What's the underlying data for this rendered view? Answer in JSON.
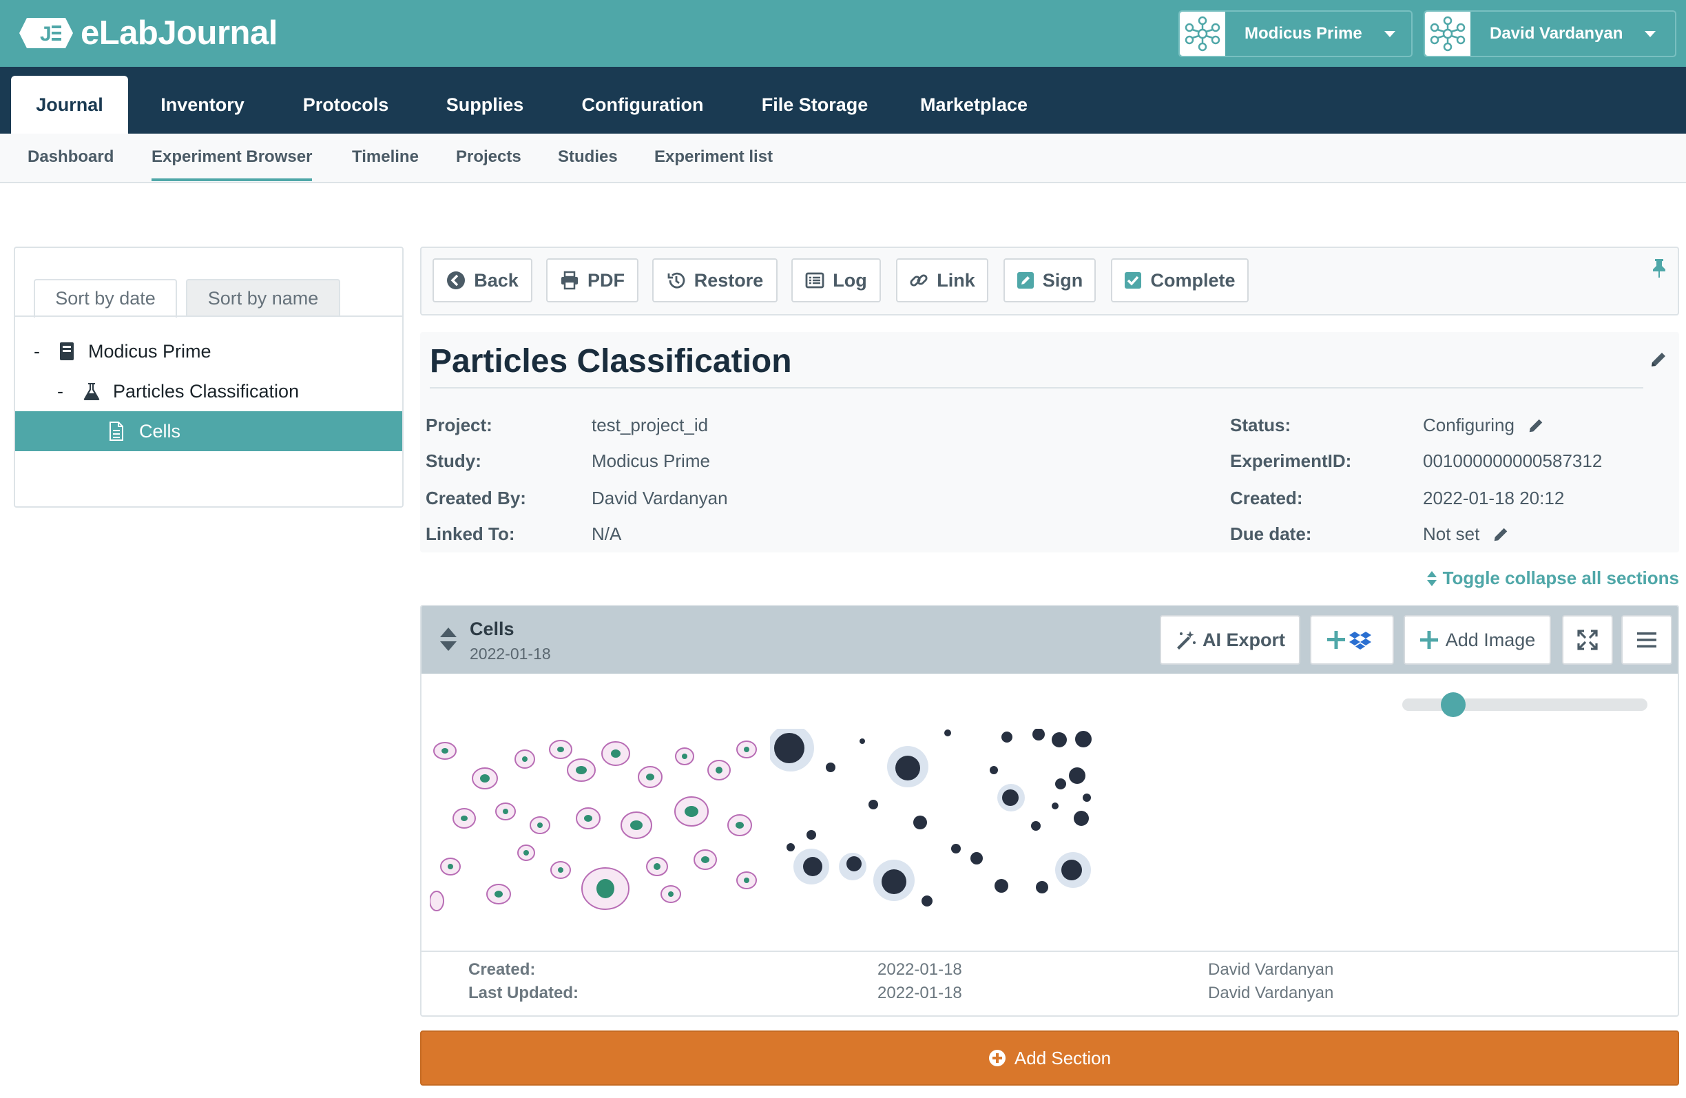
{
  "app": {
    "name": "eLabJournal",
    "logo_letter": "J"
  },
  "accounts": [
    {
      "name": "Modicus Prime"
    },
    {
      "name": "David Vardanyan"
    }
  ],
  "main_nav": [
    "Journal",
    "Inventory",
    "Protocols",
    "Supplies",
    "Configuration",
    "File Storage",
    "Marketplace"
  ],
  "main_nav_active": "Journal",
  "sub_nav": [
    "Dashboard",
    "Experiment Browser",
    "Timeline",
    "Projects",
    "Studies",
    "Experiment list"
  ],
  "sub_nav_active": "Experiment Browser",
  "sidebar": {
    "sort_tabs": [
      "Sort by date",
      "Sort by name"
    ],
    "tree": [
      {
        "toggle": "-",
        "label": "Modicus Prime",
        "icon": "book-icon"
      },
      {
        "toggle": "-",
        "label": "Particles Classification",
        "icon": "flask-icon"
      },
      {
        "toggle": "",
        "label": "Cells",
        "icon": "file-icon",
        "selected": true
      }
    ]
  },
  "toolbar": {
    "buttons": [
      {
        "label": "Back",
        "icon": "back-circle-icon"
      },
      {
        "label": "PDF",
        "icon": "printer-icon"
      },
      {
        "label": "Restore",
        "icon": "history-icon"
      },
      {
        "label": "Log",
        "icon": "list-icon"
      },
      {
        "label": "Link",
        "icon": "link-icon"
      },
      {
        "label": "Sign",
        "icon": "sign-icon"
      },
      {
        "label": "Complete",
        "icon": "check-square-icon"
      }
    ]
  },
  "experiment": {
    "title": "Particles Classification",
    "fields_left": [
      {
        "label": "Project:",
        "value": "test_project_id"
      },
      {
        "label": "Study:",
        "value": "Modicus Prime"
      },
      {
        "label": "Created By:",
        "value": "David Vardanyan"
      },
      {
        "label": "Linked To:",
        "value": "N/A"
      }
    ],
    "fields_right": [
      {
        "label": "Status:",
        "value": "Configuring"
      },
      {
        "label": "ExperimentID:",
        "value": "001000000000587312"
      },
      {
        "label": "Created:",
        "value": "2022-01-18 20:12"
      },
      {
        "label": "Due date:",
        "value": "Not set"
      }
    ],
    "toggle_sections": "Toggle collapse all sections"
  },
  "section": {
    "name": "Cells",
    "date": "2022-01-18",
    "ai_export": "AI Export",
    "add_image": "Add Image",
    "zoom_level": 0.18,
    "footer": {
      "created_label": "Created:",
      "created_date": "2022-01-18",
      "created_by": "David Vardanyan",
      "updated_label": "Last Updated:",
      "updated_date": "2022-01-18",
      "updated_by": "David Vardanyan"
    }
  },
  "add_section": "Add Section",
  "colors": {
    "teal": "#4fa7a8",
    "navy": "#1a3a52",
    "orange": "#d9772b"
  }
}
